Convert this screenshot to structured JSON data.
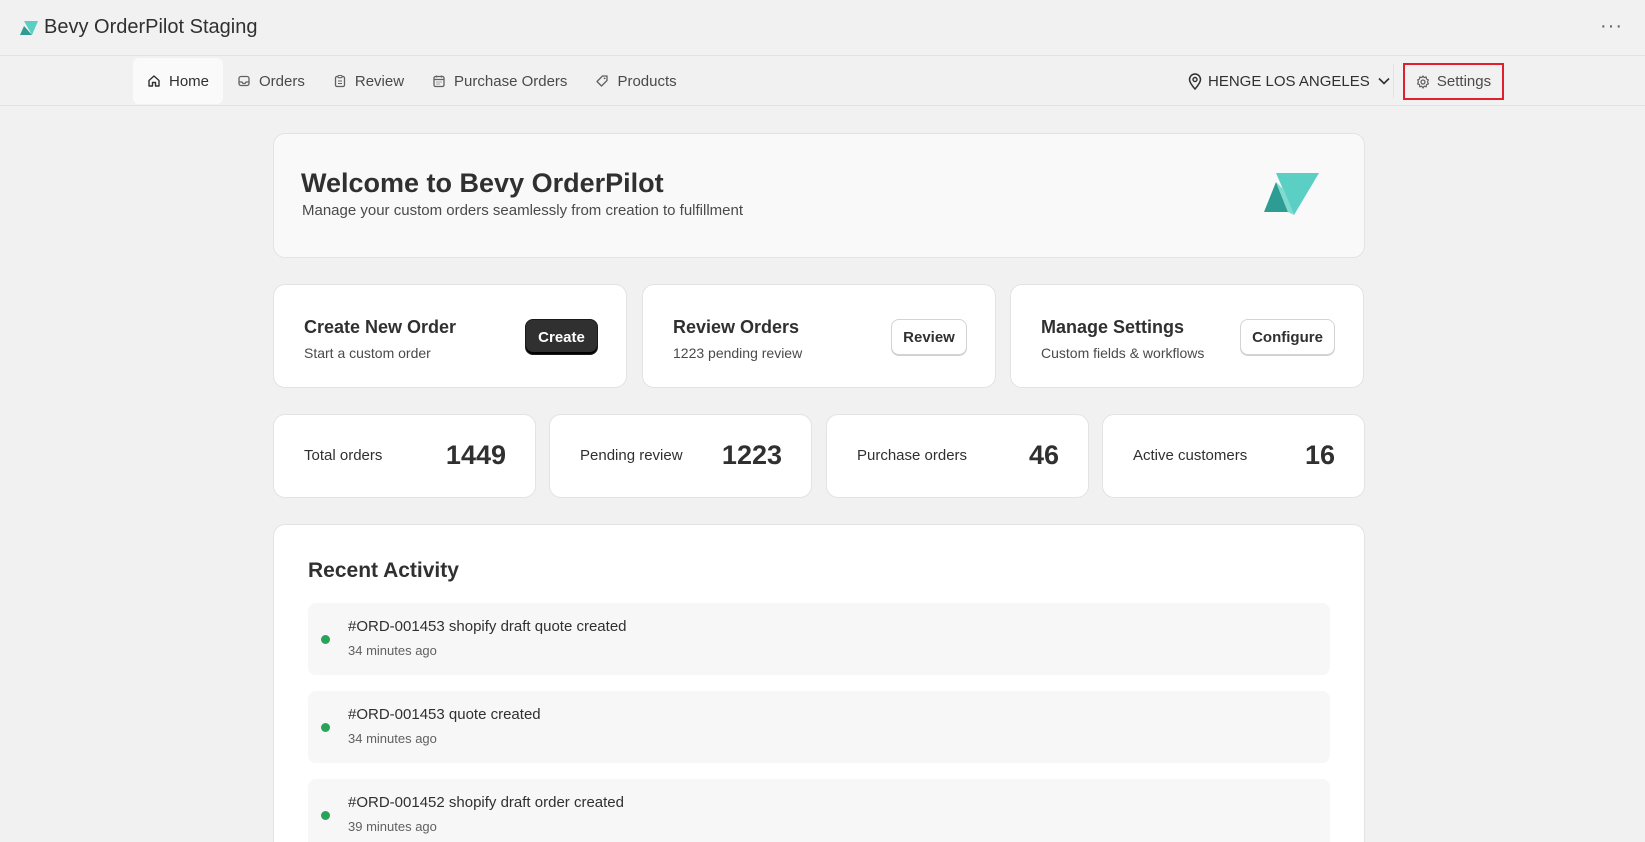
{
  "app": {
    "title": "Bevy OrderPilot Staging",
    "more_label": "···"
  },
  "nav": {
    "tabs": [
      {
        "label": "Home",
        "icon": "home-icon",
        "active": true
      },
      {
        "label": "Orders",
        "icon": "inbox-icon",
        "active": false
      },
      {
        "label": "Review",
        "icon": "clipboard-icon",
        "active": false
      },
      {
        "label": "Purchase Orders",
        "icon": "calendar-icon",
        "active": false
      },
      {
        "label": "Products",
        "icon": "tag-icon",
        "active": false
      }
    ],
    "location": "HENGE LOS ANGELES",
    "settings_label": "Settings"
  },
  "welcome": {
    "title": "Welcome to Bevy OrderPilot",
    "subtitle": "Manage your custom orders seamlessly from creation to fulfillment"
  },
  "actions": [
    {
      "title": "Create New Order",
      "subtitle": "Start a custom order",
      "button": "Create"
    },
    {
      "title": "Review Orders",
      "subtitle": "1223 pending review",
      "button": "Review"
    },
    {
      "title": "Manage Settings",
      "subtitle": "Custom fields & workflows",
      "button": "Configure"
    }
  ],
  "stats": [
    {
      "label": "Total orders",
      "value": "1449"
    },
    {
      "label": "Pending review",
      "value": "1223"
    },
    {
      "label": "Purchase orders",
      "value": "46"
    },
    {
      "label": "Active customers",
      "value": "16"
    }
  ],
  "activity": {
    "title": "Recent Activity",
    "items": [
      {
        "text": "#ORD-001453 shopify draft quote created",
        "time": "34 minutes ago"
      },
      {
        "text": "#ORD-001453 quote created",
        "time": "34 minutes ago"
      },
      {
        "text": "#ORD-001452 shopify draft order created",
        "time": "39 minutes ago"
      }
    ]
  },
  "colors": {
    "accent_teal": "#5ccfc4",
    "status_dot": "#29a35a",
    "highlight_red": "#e0202a"
  }
}
